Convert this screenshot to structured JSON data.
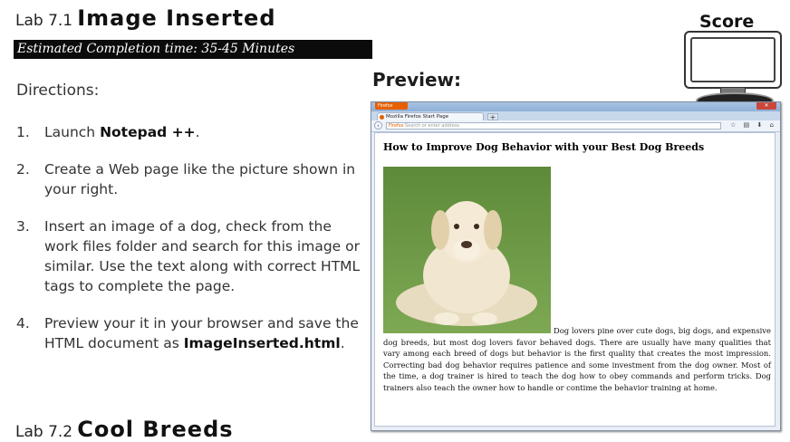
{
  "lab1": {
    "number": "Lab 7.1",
    "title": "Image Inserted",
    "estimate": "Estimated Completion time: 35-45 Minutes"
  },
  "directions": {
    "heading": "Directions:",
    "steps": [
      {
        "num": "1.",
        "text_before": "Launch ",
        "bold": "Notepad ++",
        "text_after": "."
      },
      {
        "num": "2.",
        "text_before": "Create a Web page like the picture shown in your right.",
        "bold": "",
        "text_after": ""
      },
      {
        "num": "3.",
        "text_before": "Insert  an image of a dog, check from the work files folder and search for this image or similar. Use the text along with correct HTML tags to complete the page.",
        "bold": "",
        "text_after": ""
      },
      {
        "num": "4.",
        "text_before": "Preview your it in your browser and save the HTML document as ",
        "bold": "ImageInserted.html",
        "text_after": "."
      }
    ]
  },
  "lab2": {
    "number": "Lab 7.2",
    "title": "Cool Breeds"
  },
  "preview_label": "Preview:",
  "score_label": "Score",
  "browser": {
    "app_button": "Firefox",
    "tab_title": "Mozilla Firefox Start Page",
    "new_tab": "+",
    "url_prefix": "Firefox",
    "url_placeholder": "Search or enter address",
    "page_heading": "How to Improve Dog Behavior with your Best Dog Breeds",
    "page_paragraph": "Dog lovers pine over cute dogs, big dogs, and expensive dog breeds, but most dog lovers favor behaved dogs. There are usually have many qualities that vary among each breed of dogs but behavior is the first quality that creates the most impression. Correcting bad dog behavior requires patience and some investment from the dog owner. Most of the time, a dog trainer is hired to teach the dog how to obey commands and perform tricks. Dog trainers also teach the owner how to handle or contime the behavior training at home."
  },
  "colors": {
    "firefox_orange": "#e66000",
    "grass_green": "#6f9a46",
    "dog_cream": "#f1e6cf"
  }
}
